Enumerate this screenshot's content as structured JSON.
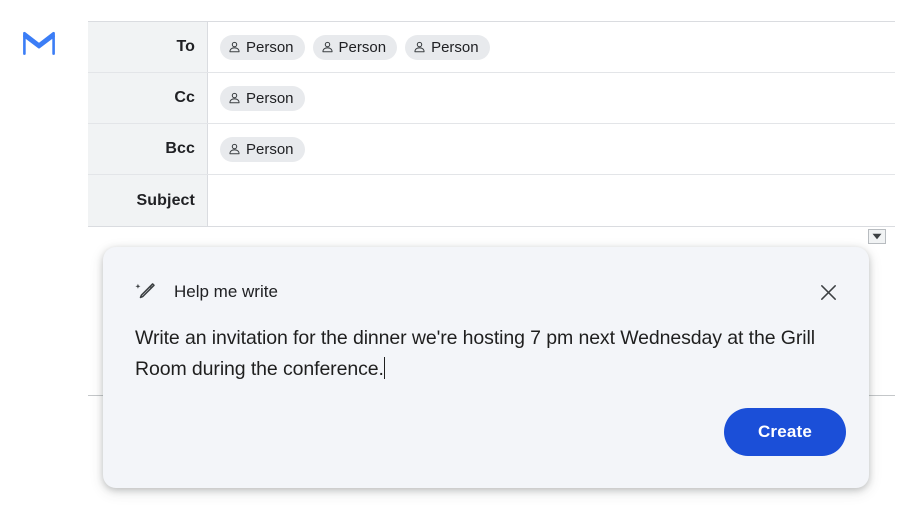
{
  "app": {
    "logo_icon": "gmail-m-logo",
    "logo_color": "#1a73e8"
  },
  "compose": {
    "rows": [
      {
        "label": "To",
        "icon": "person-icon",
        "chips": [
          {
            "icon": "person-icon",
            "label": "Person"
          },
          {
            "icon": "person-icon",
            "label": "Person"
          },
          {
            "icon": "person-icon",
            "label": "Person"
          }
        ]
      },
      {
        "label": "Cc",
        "icon": "person-icon",
        "chips": [
          {
            "icon": "person-icon",
            "label": "Person"
          }
        ]
      },
      {
        "label": "Bcc",
        "icon": "person-icon",
        "chips": [
          {
            "icon": "person-icon",
            "label": "Person"
          }
        ]
      },
      {
        "label": "Subject",
        "icon": "none",
        "chips": []
      }
    ],
    "collapse_button_icon": "chevron-down-icon"
  },
  "help_me_write": {
    "icon": "magic-pen-icon",
    "title": "Help me write",
    "close_icon": "close-icon",
    "prompt_value": "Write an invitation for the dinner we're hosting 7 pm next Wednesday at the Grill Room during the conference.",
    "caret_visible": true,
    "create_label": "Create",
    "create_color": "#1b4fd8",
    "dialog_background": "#f3f5f9"
  }
}
